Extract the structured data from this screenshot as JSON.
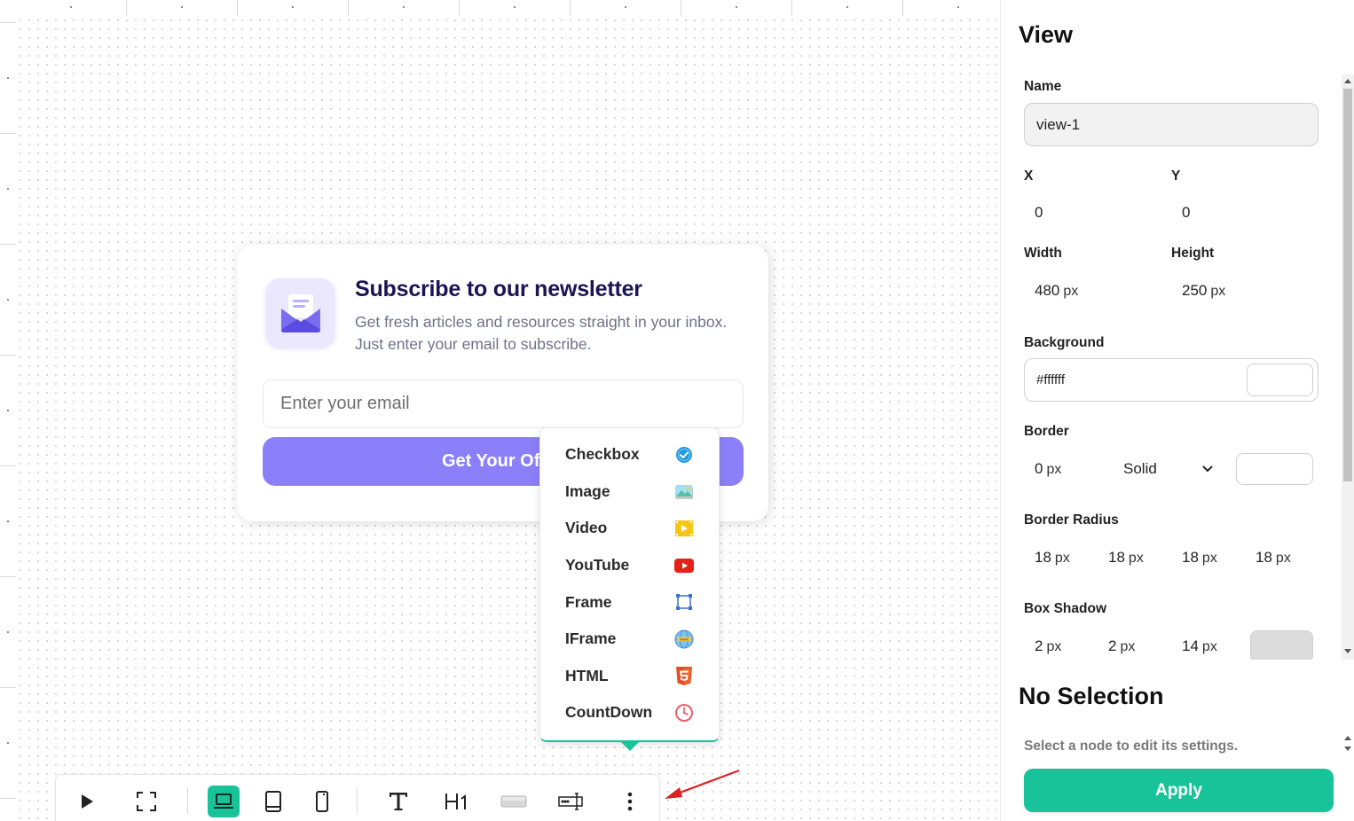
{
  "canvas": {
    "card": {
      "title": "Subscribe to our newsletter",
      "description": "Get fresh articles and resources straight in your inbox. Just enter your email to subscribe.",
      "email_placeholder": "Enter your email",
      "cta_label": "Get Your Of",
      "icon": "envelope-icon"
    },
    "popup_menu": {
      "items": [
        {
          "label": "Checkbox",
          "icon": "checkbox-icon"
        },
        {
          "label": "Image",
          "icon": "image-icon"
        },
        {
          "label": "Video",
          "icon": "video-icon"
        },
        {
          "label": "YouTube",
          "icon": "youtube-icon"
        },
        {
          "label": "Frame",
          "icon": "frame-icon"
        },
        {
          "label": "IFrame",
          "icon": "iframe-icon"
        },
        {
          "label": "HTML",
          "icon": "html5-icon"
        },
        {
          "label": "CountDown",
          "icon": "countdown-icon"
        }
      ],
      "accent": "#19c39a"
    },
    "toolbar": {
      "buttons": [
        "play-icon",
        "fullscreen-icon",
        "desktop-icon",
        "tablet-icon",
        "mobile-icon",
        "text-icon",
        "heading-icon",
        "button-icon",
        "input-icon",
        "more-icon"
      ],
      "active": "desktop-icon"
    }
  },
  "panel": {
    "title": "View",
    "name_label": "Name",
    "name_value": "view-1",
    "x_label": "X",
    "x_value": "0",
    "y_label": "Y",
    "y_value": "0",
    "width_label": "Width",
    "width_value": "480",
    "height_label": "Height",
    "height_value": "250",
    "unit": "px",
    "background_label": "Background",
    "background_value": "#ffffff",
    "border_label": "Border",
    "border_width": "0",
    "border_style": "Solid",
    "border_radius_label": "Border Radius",
    "border_radius": [
      "18",
      "18",
      "18",
      "18"
    ],
    "box_shadow_label": "Box Shadow",
    "box_shadow": [
      "2",
      "2",
      "14"
    ],
    "shadow_color": "#dcdcdc"
  },
  "no_selection": {
    "title": "No Selection",
    "description": "Select a node to edit its settings.",
    "apply_label": "Apply"
  },
  "colors": {
    "accent": "#19c39a",
    "cta": "#8b80f9",
    "card_title": "#1c1454",
    "annotation_arrow": "#e02020"
  }
}
